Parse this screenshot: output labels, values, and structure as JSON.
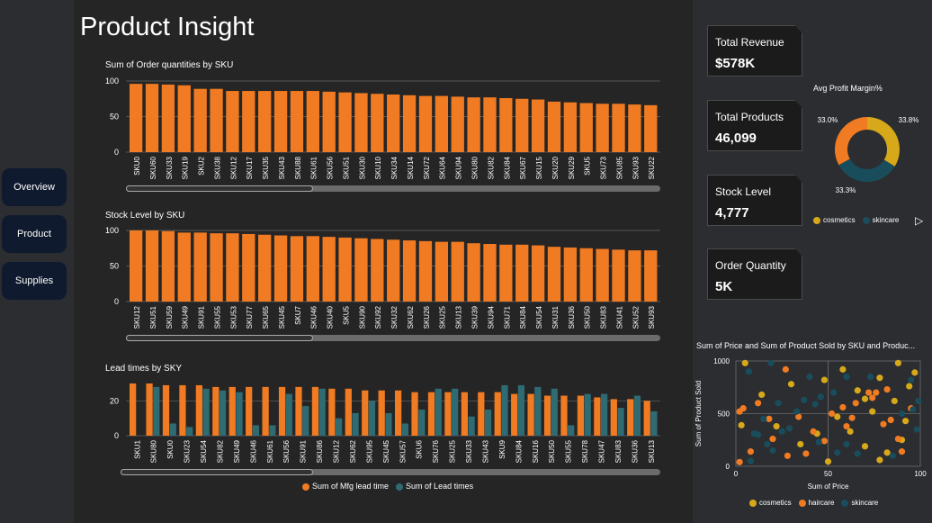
{
  "page": {
    "title": "Product Insight"
  },
  "nav": {
    "items": [
      {
        "label": "Overview"
      },
      {
        "label": "Product"
      },
      {
        "label": "Supplies"
      }
    ]
  },
  "colors": {
    "orange": "#f07b22",
    "teal": "#2f6b72",
    "yellow": "#d6a81a",
    "skinteal": "#1a4d5c"
  },
  "cards": [
    {
      "label": "Total Revenue",
      "value": "$578K"
    },
    {
      "label": "Total Products",
      "value": "46,099"
    },
    {
      "label": "Stock Level",
      "value": "4,777"
    },
    {
      "label": "Order Quantity",
      "value": "5K"
    }
  ],
  "chart_data": [
    {
      "type": "bar",
      "title": "Sum of Order quantities by SKU",
      "yticks": [
        0,
        50,
        100
      ],
      "ylim": [
        0,
        100
      ],
      "categories": [
        "SKU0",
        "SKU60",
        "SKU33",
        "SKU19",
        "SKU2",
        "SKU38",
        "SKU12",
        "SKU17",
        "SKU35",
        "SKU43",
        "SKU88",
        "SKU61",
        "SKU56",
        "SKU51",
        "SKU30",
        "SKU10",
        "SKU34",
        "SKU14",
        "SKU72",
        "SKU64",
        "SKU94",
        "SKU80",
        "SKU82",
        "SKU84",
        "SKU67",
        "SKU15",
        "SKU20",
        "SKU29",
        "SKU5",
        "SKU73",
        "SKU85",
        "SKU93",
        "SKU22"
      ],
      "values": [
        96,
        96,
        95,
        94,
        89,
        89,
        86,
        86,
        86,
        86,
        86,
        86,
        85,
        84,
        83,
        82,
        81,
        80,
        79,
        79,
        78,
        77,
        77,
        76,
        75,
        74,
        71,
        70,
        69,
        68,
        68,
        67,
        66
      ],
      "color": "#f07b22"
    },
    {
      "type": "bar",
      "title": "Stock Level by SKU",
      "yticks": [
        0,
        50,
        100
      ],
      "ylim": [
        0,
        100
      ],
      "categories": [
        "SKU12",
        "SKU51",
        "SKU59",
        "SKU49",
        "SKU91",
        "SKU55",
        "SKU53",
        "SKU77",
        "SKU65",
        "SKU45",
        "SKU7",
        "SKU46",
        "SKU40",
        "SKU5",
        "SKU90",
        "SKU92",
        "SKU32",
        "SKU62",
        "SKU26",
        "SKU25",
        "SKU13",
        "SKU39",
        "SKU94",
        "SKU71",
        "SKU84",
        "SKU54",
        "SKU31",
        "SKU36",
        "SKU50",
        "SKU83",
        "SKU41",
        "SKU52",
        "SKU93"
      ],
      "values": [
        100,
        100,
        99,
        97,
        97,
        96,
        96,
        95,
        94,
        93,
        92,
        92,
        91,
        90,
        89,
        88,
        87,
        86,
        85,
        84,
        84,
        82,
        81,
        80,
        80,
        79,
        77,
        76,
        75,
        74,
        73,
        72,
        72
      ],
      "color": "#f07b22"
    },
    {
      "type": "bar",
      "title": "Lead times by SKY",
      "yticks": [
        0,
        20
      ],
      "ylim": [
        0,
        30
      ],
      "categories": [
        "SKU1",
        "SKU80",
        "SKU0",
        "SKU23",
        "SKU54",
        "SKU82",
        "SKU49",
        "SKU46",
        "SKU61",
        "SKU56",
        "SKU91",
        "SKU86",
        "SKU12",
        "SKU62",
        "SKU95",
        "SKU45",
        "SKU57",
        "SKU6",
        "SKU76",
        "SKU25",
        "SKU33",
        "SKU43",
        "SKU9",
        "SKU84",
        "SKU16",
        "SKU50",
        "SKU55",
        "SKU78",
        "SKU47",
        "SKU83",
        "SKU36",
        "SKU13"
      ],
      "series": [
        {
          "name": "Sum of Mfg lead time",
          "values": [
            30,
            30,
            29,
            29,
            29,
            28,
            28,
            28,
            28,
            28,
            28,
            28,
            27,
            27,
            26,
            26,
            26,
            25,
            25,
            25,
            25,
            25,
            25,
            24,
            24,
            23,
            23,
            23,
            22,
            21,
            21,
            20
          ]
        },
        {
          "name": "Sum of Lead times",
          "values": [
            0,
            28,
            7,
            5,
            27,
            26,
            25,
            6,
            6,
            24,
            17,
            27,
            10,
            13,
            20,
            13,
            7,
            15,
            27,
            27,
            11,
            15,
            29,
            29,
            28,
            27,
            6,
            24,
            24,
            16,
            23,
            14
          ]
        }
      ],
      "legend": "bottom"
    },
    {
      "type": "pie",
      "title": "Avg Profit Margin%",
      "slices": [
        {
          "name": "haircare",
          "value": 33.0,
          "label": "33.0%"
        },
        {
          "name": "cosmetics",
          "value": 33.8,
          "label": "33.8%"
        },
        {
          "name": "skincare",
          "value": 33.3,
          "label": "33.3%"
        }
      ],
      "legend": [
        "cosmetics",
        "skincare"
      ]
    },
    {
      "type": "scatter",
      "title": "Sum of Price and Sum of Product Sold by SKU and Produc...",
      "xlabel": "Sum of Price",
      "ylabel": "Sum of Product Sold",
      "xlim": [
        0,
        100
      ],
      "ylim": [
        0,
        1000
      ],
      "xticks": [
        0,
        50,
        100
      ],
      "yticks": [
        0,
        500,
        1000
      ],
      "legend": [
        "cosmetics",
        "haircare",
        "skincare"
      ],
      "series": [
        {
          "name": "cosmetics",
          "points": [
            [
              5,
              980
            ],
            [
              58,
              920
            ],
            [
              97,
              890
            ],
            [
              55,
              470
            ],
            [
              48,
              820
            ],
            [
              62,
              330
            ],
            [
              70,
              190
            ],
            [
              82,
              130
            ],
            [
              90,
              250
            ],
            [
              78,
              840
            ],
            [
              86,
              620
            ],
            [
              94,
              760
            ],
            [
              74,
              520
            ],
            [
              14,
              680
            ],
            [
              22,
              380
            ],
            [
              88,
              980
            ],
            [
              66,
              720
            ],
            [
              50,
              45
            ],
            [
              3,
              390
            ],
            [
              44,
              310
            ],
            [
              30,
              780
            ],
            [
              70,
              640
            ],
            [
              92,
              430
            ],
            [
              35,
              210
            ],
            [
              78,
              60
            ]
          ]
        },
        {
          "name": "haircare",
          "points": [
            [
              4,
              550
            ],
            [
              2,
              520
            ],
            [
              8,
              140
            ],
            [
              18,
              450
            ],
            [
              27,
              920
            ],
            [
              12,
              600
            ],
            [
              52,
              500
            ],
            [
              65,
              600
            ],
            [
              74,
              650
            ],
            [
              76,
              700
            ],
            [
              82,
              730
            ],
            [
              88,
              260
            ],
            [
              95,
              550
            ],
            [
              48,
              240
            ],
            [
              2,
              40
            ],
            [
              38,
              120
            ],
            [
              84,
              440
            ],
            [
              63,
              460
            ],
            [
              72,
              700
            ],
            [
              58,
              560
            ],
            [
              34,
              470
            ],
            [
              90,
              140
            ],
            [
              60,
              380
            ],
            [
              42,
              330
            ],
            [
              80,
              400
            ],
            [
              28,
              100
            ],
            [
              20,
              260
            ]
          ]
        },
        {
          "name": "skincare",
          "points": [
            [
              7,
              900
            ],
            [
              10,
              310
            ],
            [
              12,
              300
            ],
            [
              17,
              210
            ],
            [
              20,
              150
            ],
            [
              29,
              360
            ],
            [
              25,
              330
            ],
            [
              40,
              850
            ],
            [
              43,
              590
            ],
            [
              46,
              660
            ],
            [
              33,
              520
            ],
            [
              37,
              630
            ],
            [
              15,
              450
            ],
            [
              60,
              850
            ],
            [
              8,
              50
            ],
            [
              55,
              130
            ],
            [
              66,
              120
            ],
            [
              96,
              540
            ],
            [
              98,
              350
            ],
            [
              99,
              620
            ],
            [
              85,
              100
            ],
            [
              73,
              850
            ],
            [
              90,
              500
            ],
            [
              23,
              600
            ],
            [
              45,
              230
            ],
            [
              19,
              980
            ],
            [
              60,
              210
            ],
            [
              53,
              700
            ],
            [
              95,
              820
            ]
          ]
        }
      ]
    }
  ]
}
